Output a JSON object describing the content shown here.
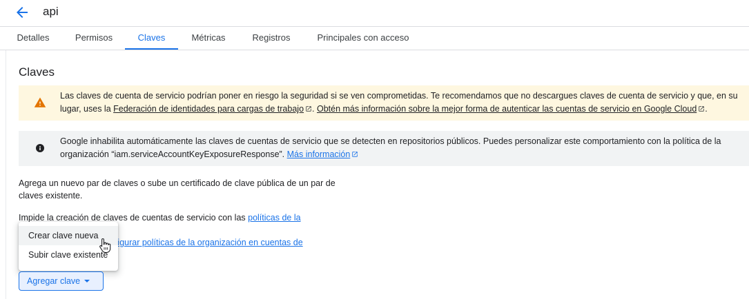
{
  "header": {
    "title": "api",
    "back_icon": "arrow-back-icon"
  },
  "tabs": [
    {
      "label": "Detalles",
      "active": false
    },
    {
      "label": "Permisos",
      "active": false
    },
    {
      "label": "Claves",
      "active": true
    },
    {
      "label": "Métricas",
      "active": false
    },
    {
      "label": "Registros",
      "active": false
    },
    {
      "label": "Principales con acceso",
      "active": false
    }
  ],
  "section": {
    "title": "Claves"
  },
  "warning_banner": {
    "icon": "warning-icon",
    "text_before": "Las claves de cuenta de servicio podrían poner en riesgo la seguridad si se ven comprometidas. Te recomendamos que no descargues claves de cuenta de servicio y que, en su lugar, uses la ",
    "link1": "Federación de identidades para cargas de trabajo",
    "text_middle": ". ",
    "link2": "Obtén más información sobre la mejor forma de autenticar las cuentas de servicio en Google Cloud",
    "text_after": "."
  },
  "info_banner": {
    "icon": "info-icon",
    "text_before": "Google inhabilita automáticamente las claves de cuentas de servicio que se detecten en repositorios públicos. Puedes personalizar este comportamiento con la política de la organización “iam.serviceAccountKeyExposureResponse”. ",
    "link": "Más información"
  },
  "body": {
    "p1": "Agrega un nuevo par de claves o sube un certificado de clave pública de un par de claves existente.",
    "p2_text": "Impide la creación de claves de cuentas de servicio con las ",
    "p2_link": "políticas de la",
    "p3_link": "nfigurar políticas de la organización en cuentas de"
  },
  "dropdown_menu": {
    "items": [
      "Crear clave nueva",
      "Subir clave existente"
    ],
    "hovered": "Crear clave nueva"
  },
  "add_key_button": {
    "label": "Agregar clave"
  },
  "colors": {
    "accent": "#1a73e8",
    "warning_bg": "#fef7e0",
    "warning_icon": "#e37400",
    "info_bg": "#f1f3f4"
  }
}
